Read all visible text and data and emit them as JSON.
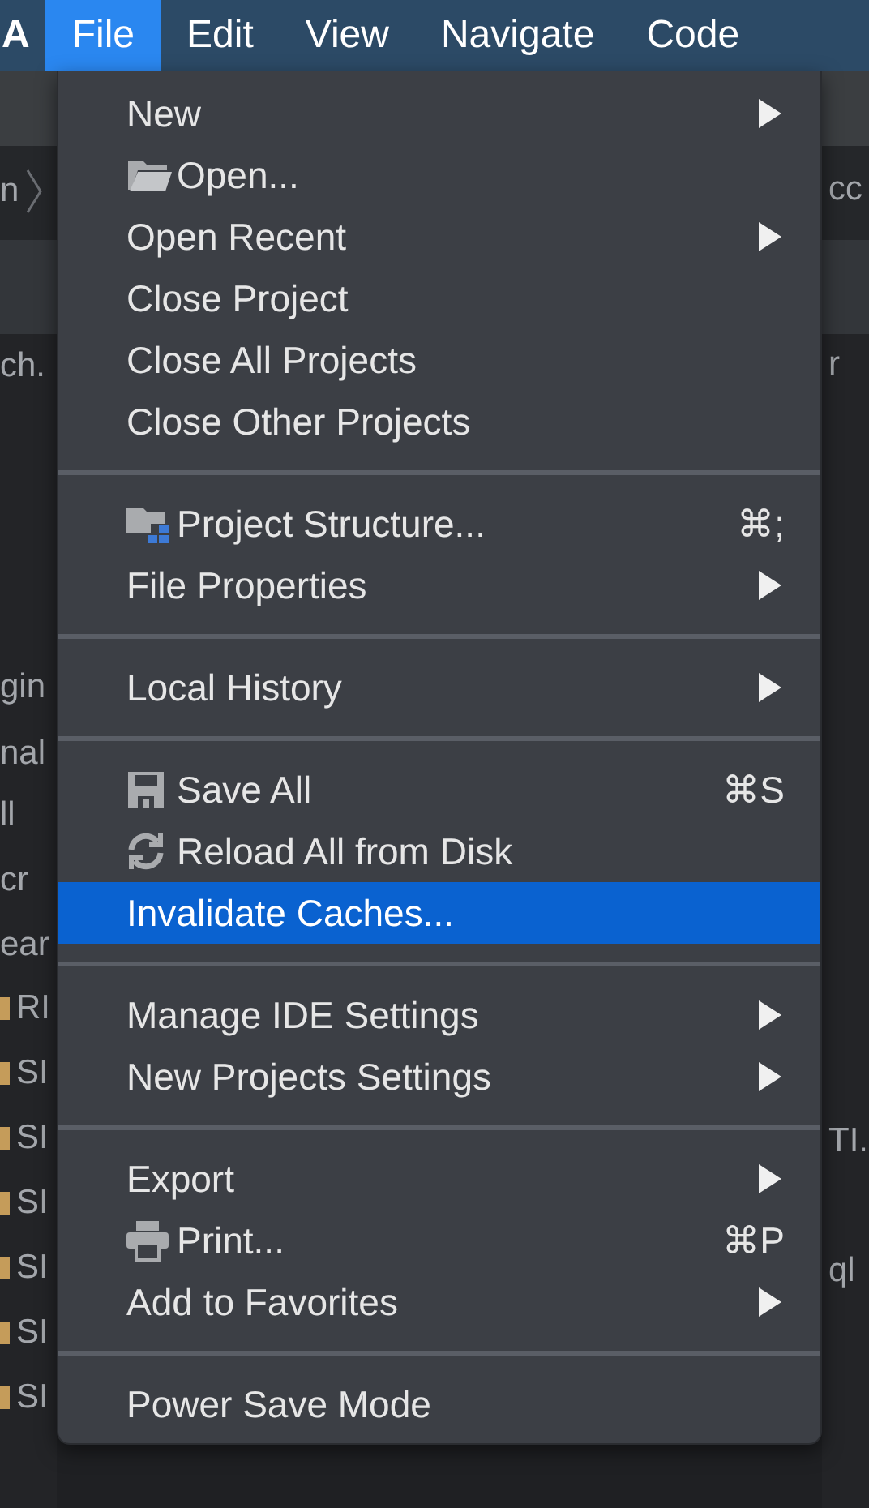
{
  "menubar": [
    {
      "label": "A",
      "selected": false
    },
    {
      "label": "File",
      "selected": true
    },
    {
      "label": "Edit",
      "selected": false
    },
    {
      "label": "View",
      "selected": false
    },
    {
      "label": "Navigate",
      "selected": false
    },
    {
      "label": "Code",
      "selected": false
    }
  ],
  "background": {
    "left": [
      {
        "text": "n",
        "kind": "crumb"
      },
      {
        "text": "ch.",
        "kind": "text"
      },
      {
        "text": "gin",
        "kind": "text"
      },
      {
        "text": "nal",
        "kind": "text"
      },
      {
        "text": "ll",
        "kind": "text"
      },
      {
        "text": "cr",
        "kind": "text"
      },
      {
        "text": "ear",
        "kind": "text"
      },
      {
        "text": "RI",
        "kind": "file"
      },
      {
        "text": "SI",
        "kind": "file"
      },
      {
        "text": "SI",
        "kind": "file"
      },
      {
        "text": "SI",
        "kind": "file"
      },
      {
        "text": "SI",
        "kind": "file"
      },
      {
        "text": "SI",
        "kind": "file"
      },
      {
        "text": "SI",
        "kind": "file"
      }
    ],
    "right": [
      {
        "text": "cc"
      },
      {
        "text": "r"
      },
      {
        "text": "TI."
      },
      {
        "text": "ql"
      }
    ]
  },
  "menu": {
    "groups": [
      {
        "items": [
          {
            "label": "New",
            "kind": "plain",
            "submenu": true,
            "selected": false
          },
          {
            "label": "Open...",
            "kind": "folder",
            "submenu": false,
            "selected": false
          },
          {
            "label": "Open Recent",
            "kind": "plain",
            "submenu": true,
            "selected": false
          },
          {
            "label": "Close Project",
            "kind": "plain",
            "submenu": false,
            "selected": false
          },
          {
            "label": "Close All Projects",
            "kind": "plain",
            "submenu": false,
            "selected": false
          },
          {
            "label": "Close Other Projects",
            "kind": "plain",
            "submenu": false,
            "selected": false
          }
        ]
      },
      {
        "items": [
          {
            "label": "Project Structure...",
            "kind": "structure",
            "shortcut": "⌘;",
            "submenu": false,
            "selected": false
          },
          {
            "label": "File Properties",
            "kind": "plain",
            "submenu": true,
            "selected": false
          }
        ]
      },
      {
        "items": [
          {
            "label": "Local History",
            "kind": "plain",
            "submenu": true,
            "selected": false
          }
        ]
      },
      {
        "items": [
          {
            "label": "Save All",
            "kind": "save",
            "shortcut": "⌘S",
            "submenu": false,
            "selected": false
          },
          {
            "label": "Reload All from Disk",
            "kind": "reload",
            "submenu": false,
            "selected": false
          },
          {
            "label": "Invalidate Caches...",
            "kind": "plain",
            "submenu": false,
            "selected": true
          }
        ]
      },
      {
        "items": [
          {
            "label": "Manage IDE Settings",
            "kind": "plain",
            "submenu": true,
            "selected": false
          },
          {
            "label": "New Projects Settings",
            "kind": "plain",
            "submenu": true,
            "selected": false
          }
        ]
      },
      {
        "items": [
          {
            "label": "Export",
            "kind": "plain",
            "submenu": true,
            "selected": false
          },
          {
            "label": "Print...",
            "kind": "printer",
            "shortcut": "⌘P",
            "submenu": false,
            "selected": false
          },
          {
            "label": "Add to Favorites",
            "kind": "plain",
            "submenu": true,
            "selected": false
          }
        ]
      },
      {
        "items": [
          {
            "label": "Power Save Mode",
            "kind": "plain",
            "submenu": false,
            "selected": false
          }
        ]
      }
    ]
  }
}
